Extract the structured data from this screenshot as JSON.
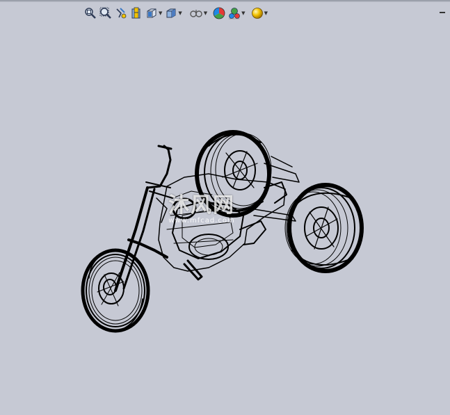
{
  "toolbar": {
    "icons": [
      {
        "name": "zoom-to-fit-icon",
        "dropdown": false
      },
      {
        "name": "zoom-to-area-icon",
        "dropdown": false
      },
      {
        "name": "previous-view-icon",
        "dropdown": false
      },
      {
        "name": "section-view-icon",
        "dropdown": false
      },
      {
        "name": "view-orientation-icon",
        "dropdown": true
      },
      {
        "name": "display-style-icon",
        "dropdown": true
      },
      {
        "name": "hide-show-items-icon",
        "dropdown": true
      },
      {
        "name": "edit-appearance-icon",
        "dropdown": false
      },
      {
        "name": "apply-scene-icon",
        "dropdown": true
      },
      {
        "name": "view-settings-icon",
        "dropdown": true
      }
    ],
    "colors": {
      "background": "#c6c9d4",
      "wireframe": "#000000",
      "appearance_red": "#e53935",
      "appearance_green": "#43a047",
      "appearance_blue": "#1e88e5",
      "scene_gold": "#f2c200"
    }
  },
  "watermark": {
    "logo_text": "沐风网",
    "url_text": "www.mfcad.com"
  }
}
